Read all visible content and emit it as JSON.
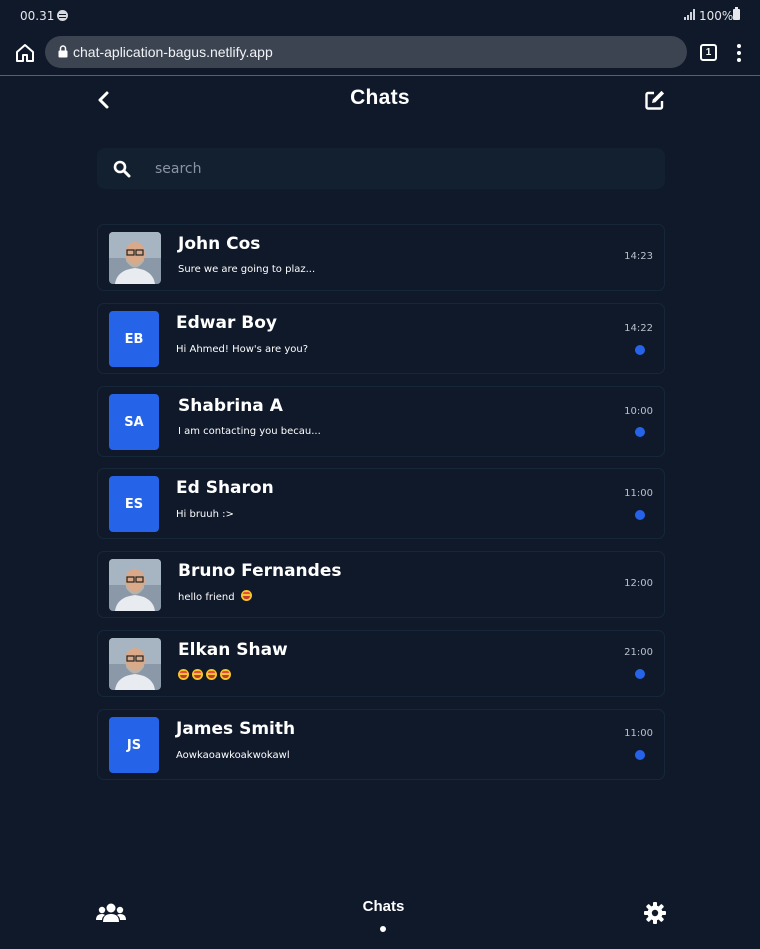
{
  "status_bar": {
    "time": "00.31",
    "battery": "100%"
  },
  "browser": {
    "url": "chat-aplication-bagus.netlify.app",
    "tab_count": "1"
  },
  "header": {
    "title": "Chats"
  },
  "search": {
    "placeholder": "search"
  },
  "chats": [
    {
      "name": "John Cos",
      "message": "Sure we are going to plaz...",
      "time": "14:23",
      "avatar": "photo",
      "unread": false
    },
    {
      "name": "Edwar Boy",
      "message": "Hi Ahmed! How's are you?",
      "time": "14:22",
      "avatar": "EB",
      "unread": true
    },
    {
      "name": "Shabrina A",
      "message": "I am contacting you becau...",
      "time": "10:00",
      "avatar": "SA",
      "unread": true
    },
    {
      "name": "Ed Sharon",
      "message": "Hi bruuh :>",
      "time": "11:00",
      "avatar": "ES",
      "unread": true
    },
    {
      "name": "Bruno Fernandes",
      "message": "hello friend",
      "emoji_count": 1,
      "time": "12:00",
      "avatar": "photo",
      "unread": false
    },
    {
      "name": "Elkan Shaw",
      "message": "",
      "emoji_count": 4,
      "time": "21:00",
      "avatar": "photo",
      "unread": true
    },
    {
      "name": "James Smith",
      "message": "Aowkaoawkoakwokawl",
      "time": "11:00",
      "avatar": "JS",
      "unread": true
    }
  ],
  "bottom_nav": {
    "active_label": "Chats"
  },
  "icons": [
    "home-icon",
    "lock-icon",
    "tabs-icon",
    "menu-icon",
    "back-icon",
    "compose-icon",
    "search-icon",
    "friends-icon",
    "settings-icon"
  ],
  "colors": {
    "background": "#0f1929",
    "accent": "#2563e8",
    "card_border": "#17273a",
    "search_bg": "#13202f"
  }
}
